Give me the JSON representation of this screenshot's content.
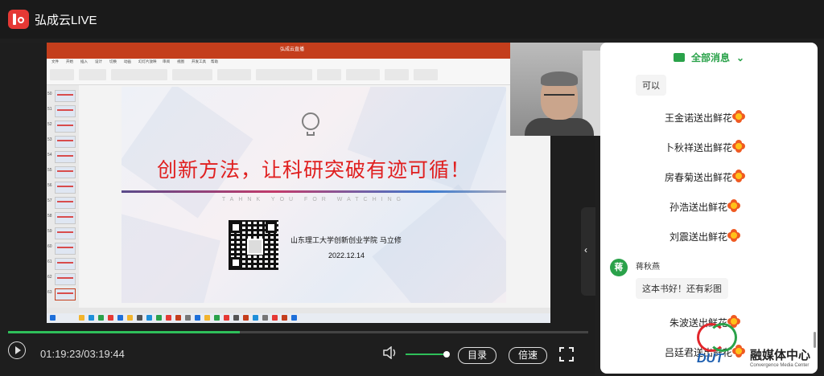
{
  "app": {
    "name": "弘成云LIVE"
  },
  "slide": {
    "title": "创新方法，让科研突破有迹可循！",
    "subtitle": "TAHNK YOU FOR WATCHING",
    "institution": "山东理工大学创新创业学院  马立修",
    "date": "2022.12.14",
    "ribbon_title": "弘成云直播",
    "ribbon_tabs": [
      "文件",
      "开始",
      "插入",
      "设计",
      "切换",
      "动画",
      "幻灯片放映",
      "审阅",
      "视图",
      "开发工具",
      "帮助"
    ],
    "thumb_numbers": [
      "50",
      "51",
      "52",
      "53",
      "54",
      "55",
      "56",
      "57",
      "58",
      "59",
      "60",
      "61",
      "62",
      "63"
    ]
  },
  "player": {
    "time": "01:19:23/03:19:44",
    "progress": 0.4,
    "volume": 0.9,
    "catalog_label": "目录",
    "speed_label": "倍速"
  },
  "chat": {
    "header": "全部消息",
    "top_reply": "可以",
    "gifts": [
      "王金诺送出鲜花",
      "卜秋祥送出鲜花",
      "房春菊送出鲜花",
      "孙浩送出鲜花",
      "刘震送出鲜花"
    ],
    "user_msg": {
      "avatar": "蒋",
      "name": "蒋秋燕",
      "text": "这本书好！还有彩图"
    },
    "gifts_bottom": [
      "朱波送出鲜花",
      "吕廷君送出鲜花"
    ]
  },
  "watermark": {
    "logo_text": "DUT",
    "name": "融媒体中心",
    "en": "Convergence Media Center"
  },
  "colors": {
    "accent": "#2aa24a",
    "brand": "#e53935",
    "slide_title": "#e02020"
  }
}
